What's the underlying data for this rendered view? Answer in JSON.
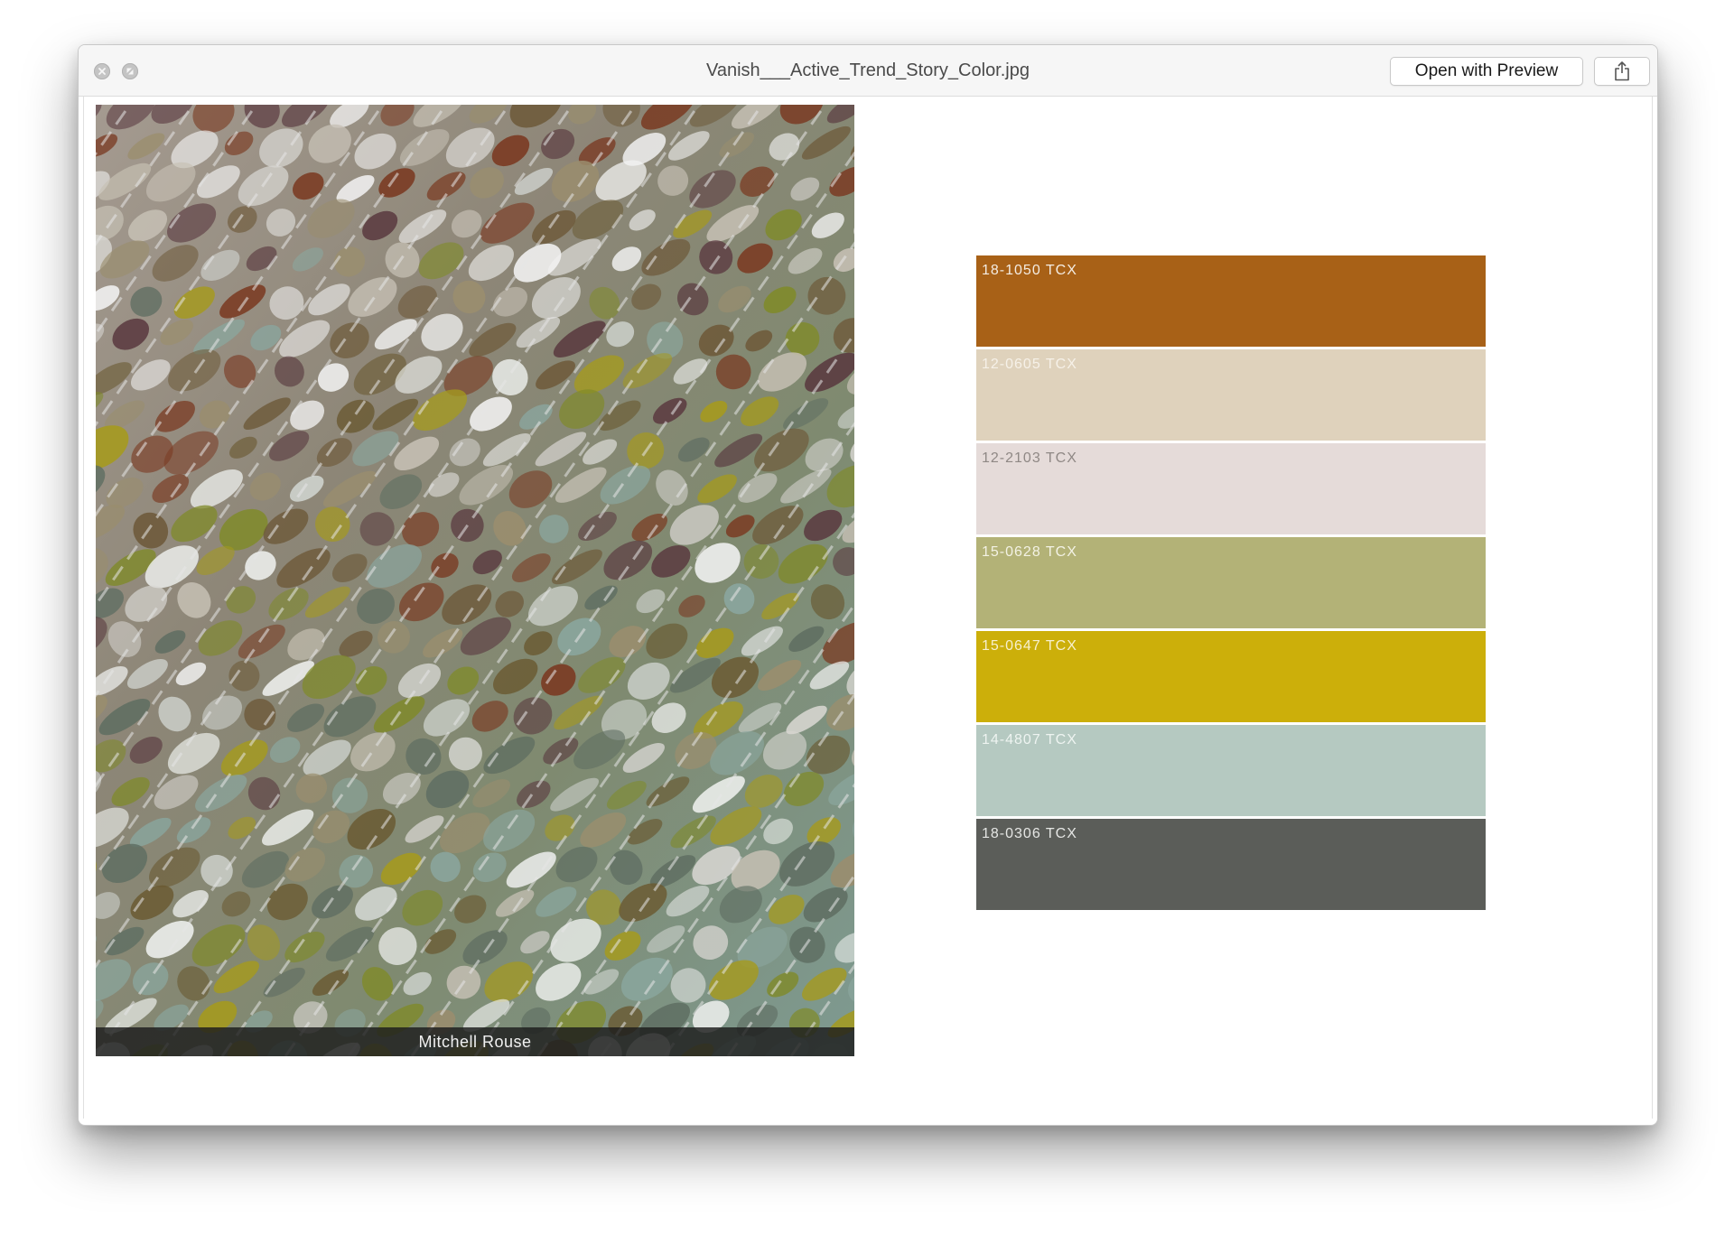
{
  "window": {
    "title": "Vanish___Active_Trend_Story_Color.jpg",
    "open_button_label": "Open with Preview",
    "close_icon": "close-icon",
    "fullscreen_icon": "fullscreen-icon",
    "share_icon": "share-icon"
  },
  "photo": {
    "caption": "Mitchell Rouse"
  },
  "palette": {
    "swatches": [
      {
        "code": "18-1050 TCX",
        "color": "#a86117",
        "text_color": "#f4ece2"
      },
      {
        "code": "12-0605 TCX",
        "color": "#dfd2bc",
        "text_color": "#f6f1e8"
      },
      {
        "code": "12-2103 TCX",
        "color": "#e5dbd9",
        "text_color": "#8f8885"
      },
      {
        "code": "15-0628 TCX",
        "color": "#b3b277",
        "text_color": "#f3f2e4"
      },
      {
        "code": "15-0647 TCX",
        "color": "#ccaf0a",
        "text_color": "#f7f0cf"
      },
      {
        "code": "14-4807 TCX",
        "color": "#b5c9c1",
        "text_color": "#eef4f1"
      },
      {
        "code": "18-0306 TCX",
        "color": "#5b5d59",
        "text_color": "#e5e6e4"
      }
    ]
  }
}
